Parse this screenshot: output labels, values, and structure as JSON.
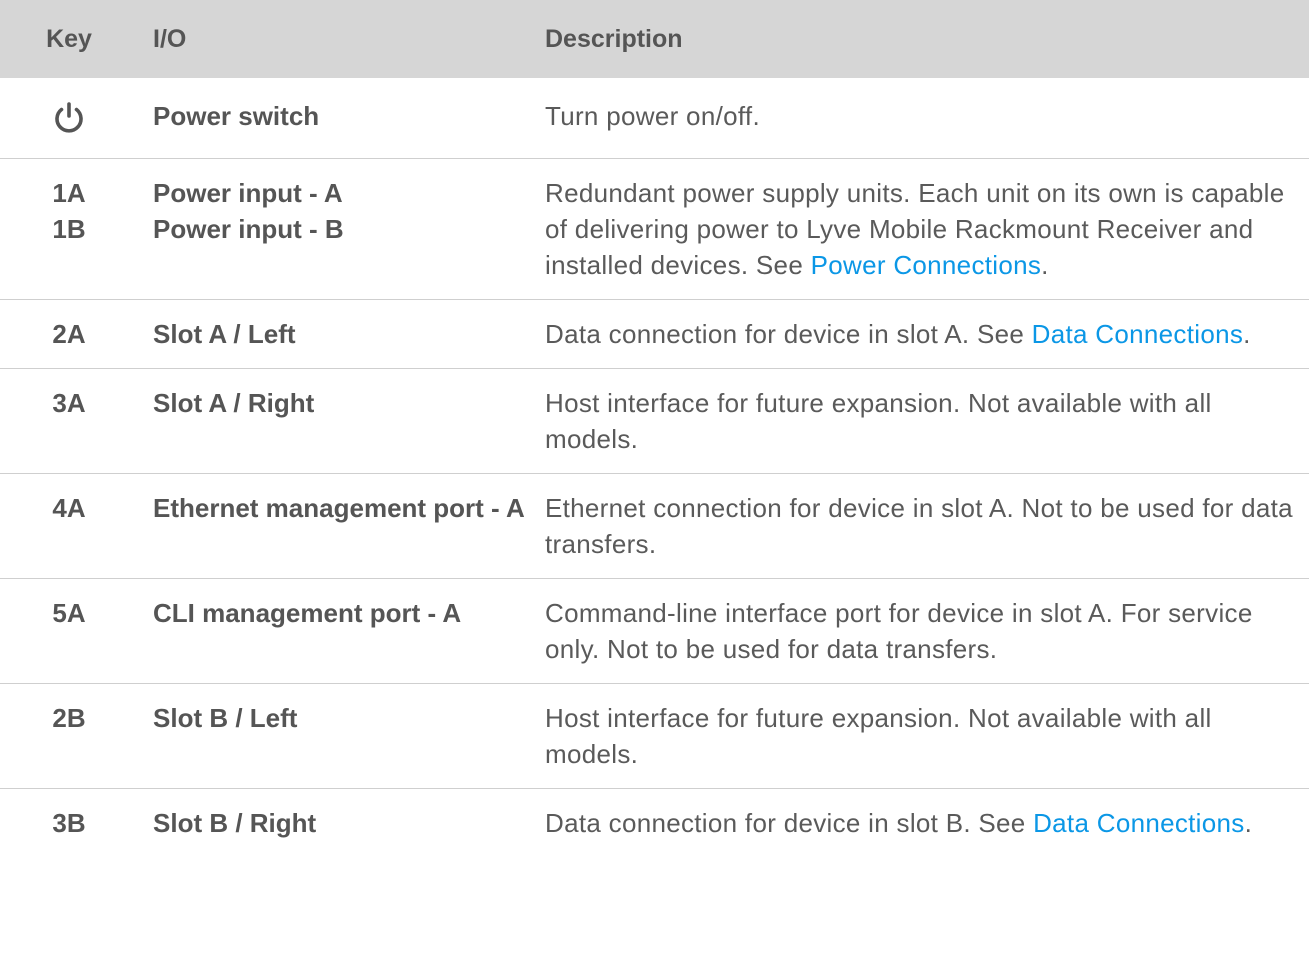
{
  "header": {
    "key": "Key",
    "io": "I/O",
    "description": "Description"
  },
  "rows": [
    {
      "key_icon": "power-icon",
      "io": [
        "Power switch"
      ],
      "desc_text": "Turn power on/off.",
      "desc_link": "",
      "desc_after": ""
    },
    {
      "keys": [
        "1A",
        "1B"
      ],
      "io": [
        "Power input - A",
        "Power input - B"
      ],
      "desc_text": "Redundant power supply units. Each unit on its own is capable of delivering power to Lyve Mobile Rackmount Receiver and installed devices. See ",
      "desc_link": "Power Connections",
      "desc_after": "."
    },
    {
      "keys": [
        "2A"
      ],
      "io": [
        "Slot A / Left"
      ],
      "desc_text": "Data connection for device in slot A. See ",
      "desc_link": "Data Connections",
      "desc_after": "."
    },
    {
      "keys": [
        "3A"
      ],
      "io": [
        "Slot A / Right"
      ],
      "desc_text": "Host interface for future expansion. Not available with all models.",
      "desc_link": "",
      "desc_after": ""
    },
    {
      "keys": [
        "4A"
      ],
      "io": [
        "Ethernet management port - A"
      ],
      "desc_text": "Ethernet connection for device in slot A. Not to be used for data transfers.",
      "desc_link": "",
      "desc_after": ""
    },
    {
      "keys": [
        "5A"
      ],
      "io": [
        "CLI management port - A"
      ],
      "desc_text": "Command-line interface port for device in slot A. For service only. Not to be used for data transfers.",
      "desc_link": "",
      "desc_after": ""
    },
    {
      "keys": [
        "2B"
      ],
      "io": [
        "Slot B / Left"
      ],
      "desc_text": "Host interface for future expansion. Not available with all models.",
      "desc_link": "",
      "desc_after": ""
    },
    {
      "keys": [
        "3B"
      ],
      "io": [
        "Slot B / Right"
      ],
      "desc_text": "Data connection for device in slot B. See ",
      "desc_link": "Data Connections",
      "desc_after": "."
    }
  ],
  "colors": {
    "header_bg": "#d6d6d6",
    "text": "#555555",
    "link": "#0b97e6",
    "divider": "#cfcfcf"
  }
}
